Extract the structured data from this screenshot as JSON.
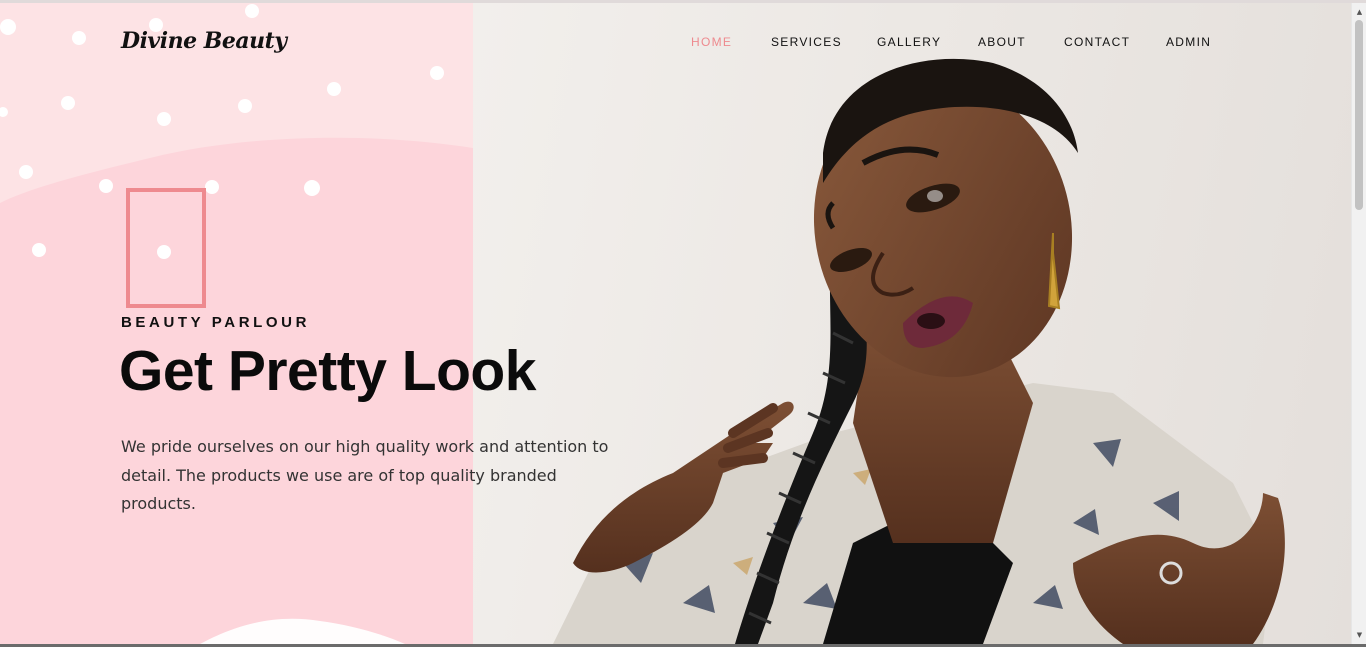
{
  "brand": {
    "logo_text": "Divine Beauty"
  },
  "nav": {
    "items": [
      {
        "label": "HOME",
        "active": true
      },
      {
        "label": "SERVICES",
        "active": false
      },
      {
        "label": "GALLERY",
        "active": false
      },
      {
        "label": "ABOUT",
        "active": false
      },
      {
        "label": "CONTACT",
        "active": false
      },
      {
        "label": "ADMIN",
        "active": false
      }
    ]
  },
  "hero": {
    "kicker": "BEAUTY PARLOUR",
    "title": "Get Pretty Look",
    "description": "We pride ourselves on our high quality work and attention to detail. The products we use are of top quality branded products."
  },
  "colors": {
    "accent": "#ee8a8f",
    "pink_panel": "#fdd5db",
    "pink_light": "#fde3e5",
    "text_dark": "#111111",
    "body_text": "#333333",
    "photo_background": "#efebe7"
  },
  "icons": {
    "scroll_up": "scroll-up-arrow-icon",
    "scroll_down": "scroll-down-arrow-icon"
  }
}
